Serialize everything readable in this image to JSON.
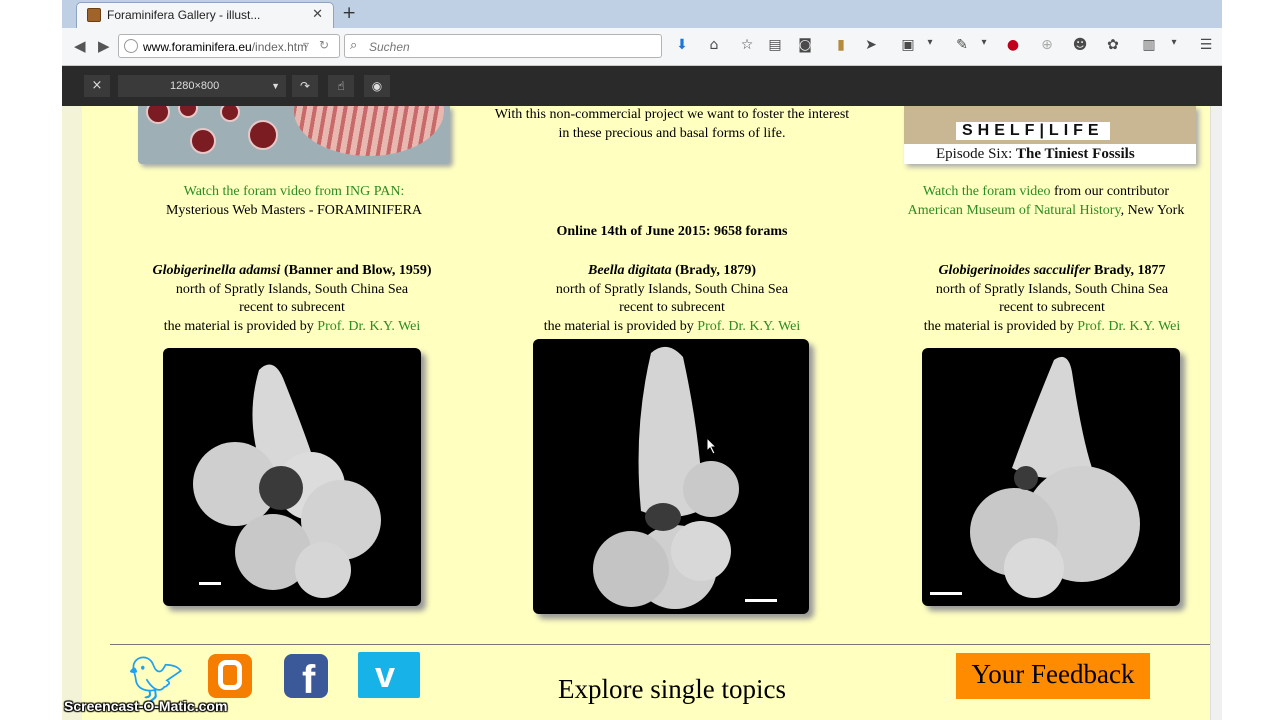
{
  "browser": {
    "tab_title": "Foraminifera Gallery - illust...",
    "tab_close": "✕",
    "new_tab": "+",
    "url_host": "www.foraminifera.eu",
    "url_path": "/index.htm",
    "search_placeholder": "Suchen"
  },
  "rdm": {
    "close": "×",
    "size": "1280×800"
  },
  "page": {
    "intro_line1": "With this non-commercial project we want to foster the interest",
    "intro_line2": "in these precious and basal forms of life.",
    "shelf_title": "SHELF|LIFE",
    "shelf_episode": "Episode Six:",
    "shelf_episode_title": "The Tiniest Fossils",
    "left_video_link": "Watch the foram video from ING PAN:",
    "left_video_sub": "Mysterious Web Masters - FORAMINIFERA",
    "right_video_link": "Watch the foram video",
    "right_video_text": "from our contributor",
    "right_museum_link": "American Museum of Natural History",
    "right_museum_place": ", New York",
    "online_count": "Online 14th of June 2015: 9658 forams"
  },
  "forams": [
    {
      "species": "Globigerinella adamsi",
      "author": "(Banner and Blow, 1959)",
      "location": "north of Spratly Islands, South China Sea",
      "age": "recent to subrecent",
      "provided_text": "the material is provided by",
      "provider": "Prof. Dr. K.Y. Wei"
    },
    {
      "species": "Beella digitata",
      "author": "(Brady, 1879)",
      "location": "north of Spratly Islands, South China Sea",
      "age": "recent to subrecent",
      "provided_text": "the material is provided by",
      "provider": "Prof. Dr. K.Y. Wei"
    },
    {
      "species": "Globigerinoides sacculifer",
      "author": "Brady, 1877",
      "location": "north of Spratly Islands, South China Sea",
      "age": "recent to subrecent",
      "provided_text": "the material is provided by",
      "provider": "Prof. Dr. K.Y. Wei"
    }
  ],
  "footer": {
    "explore": "Explore single topics",
    "feedback": "Your Feedback"
  },
  "watermark": "Screencast-O-Matic.com",
  "colors": {
    "page_bg": "#ffffc0",
    "link_green": "#2e8b20",
    "feedback_orange": "#ff8c00"
  }
}
